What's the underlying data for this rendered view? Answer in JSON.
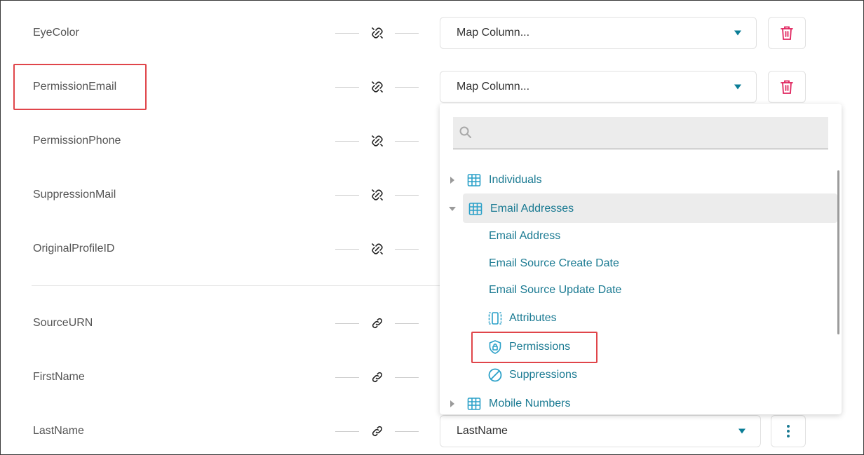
{
  "mapping_rows": [
    {
      "label": "EyeColor",
      "select_value": "Map Column...",
      "action": "delete"
    },
    {
      "label": "PermissionEmail",
      "select_value": "Map Column...",
      "action": "delete"
    },
    {
      "label": "PermissionPhone"
    },
    {
      "label": "SuppressionMail"
    },
    {
      "label": "OriginalProfileID"
    },
    {
      "label": "SourceURN"
    },
    {
      "label": "FirstName"
    },
    {
      "label": "LastName",
      "select_value": "LastName",
      "action": "more"
    }
  ],
  "dropdown": {
    "search_placeholder": "",
    "items": [
      {
        "label": "Individuals",
        "icon": "table-icon",
        "expanded": false
      },
      {
        "label": "Email Addresses",
        "icon": "table-icon",
        "expanded": true,
        "selected": true
      },
      {
        "label": "Email Address"
      },
      {
        "label": "Email Source Create Date"
      },
      {
        "label": "Email Source Update Date"
      },
      {
        "label": "Attributes",
        "icon": "attributes-icon"
      },
      {
        "label": "Permissions",
        "icon": "shield-lock-icon",
        "highlighted": true
      },
      {
        "label": "Suppressions",
        "icon": "block-icon"
      },
      {
        "label": "Mobile Numbers",
        "icon": "table-icon",
        "expanded": false
      }
    ]
  },
  "colors": {
    "accent": "#1a7a92",
    "delete": "#e0245e",
    "highlight_border": "#e0454a"
  }
}
